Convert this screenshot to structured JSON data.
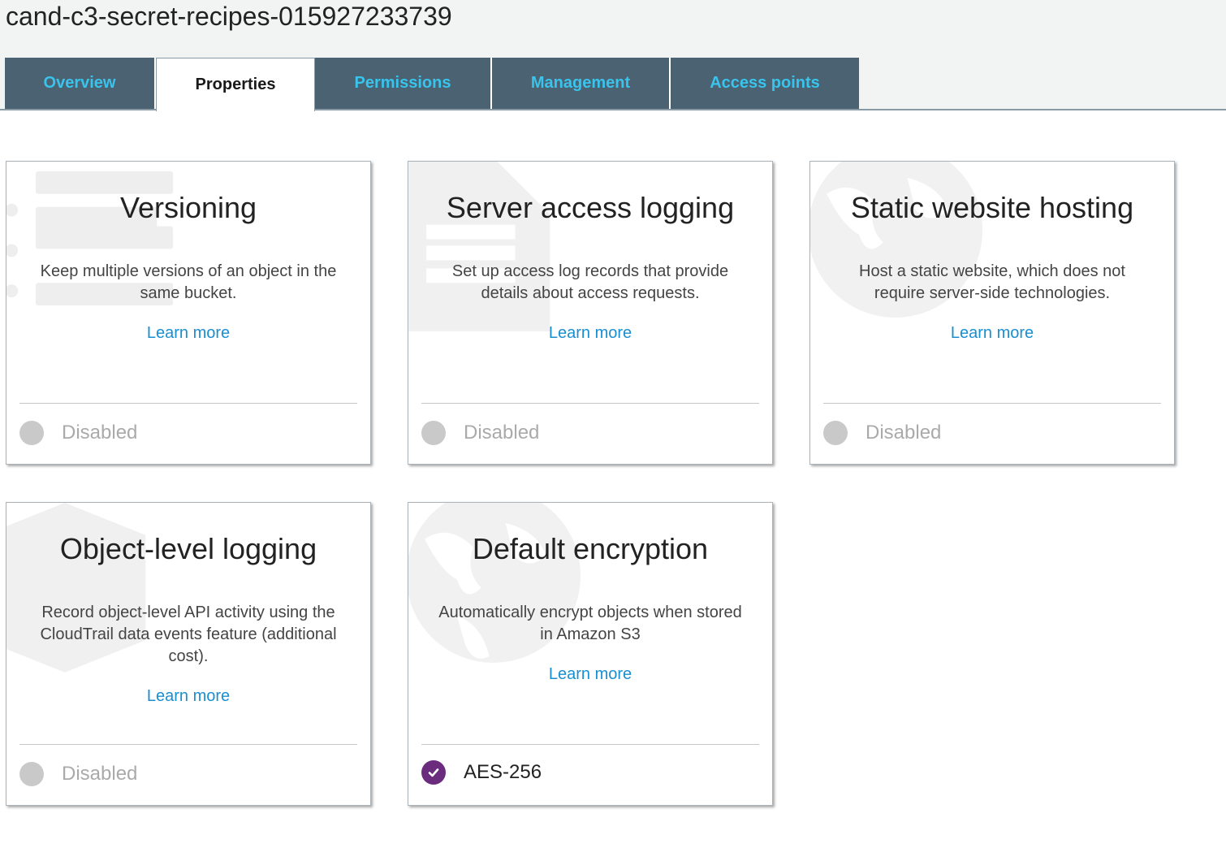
{
  "bucket": {
    "name": "cand-c3-secret-recipes-015927233739"
  },
  "tabs": [
    {
      "label": "Overview"
    },
    {
      "label": "Properties"
    },
    {
      "label": "Permissions"
    },
    {
      "label": "Management"
    },
    {
      "label": "Access points"
    }
  ],
  "active_tab": "Properties",
  "cards": [
    {
      "title": "Versioning",
      "description": "Keep multiple versions of an object in the same bucket.",
      "link": "Learn more",
      "status": "Disabled",
      "enabled": false,
      "icon": "versioning-icon"
    },
    {
      "title": "Server access logging",
      "description": "Set up access log records that provide details about access requests.",
      "link": "Learn more",
      "status": "Disabled",
      "enabled": false,
      "icon": "document-icon"
    },
    {
      "title": "Static website hosting",
      "description": "Host a static website, which does not require server-side technologies.",
      "link": "Learn more",
      "status": "Disabled",
      "enabled": false,
      "icon": "globe-icon"
    },
    {
      "title": "Object-level logging",
      "description": "Record object-level API activity using the CloudTrail data events feature (additional cost).",
      "link": "Learn more",
      "status": "Disabled",
      "enabled": false,
      "icon": "hexagon-icon"
    },
    {
      "title": "Default encryption",
      "description": "Automatically encrypt objects when stored in Amazon S3",
      "link": "Learn more",
      "status": "AES-256",
      "enabled": true,
      "icon": "globe-icon"
    }
  ],
  "colors": {
    "tab_bg": "#4b6272",
    "tab_text": "#38c4ec",
    "link": "#1a8fd0",
    "check": "#6b2c7e",
    "disabled": "#c9c9c9"
  }
}
